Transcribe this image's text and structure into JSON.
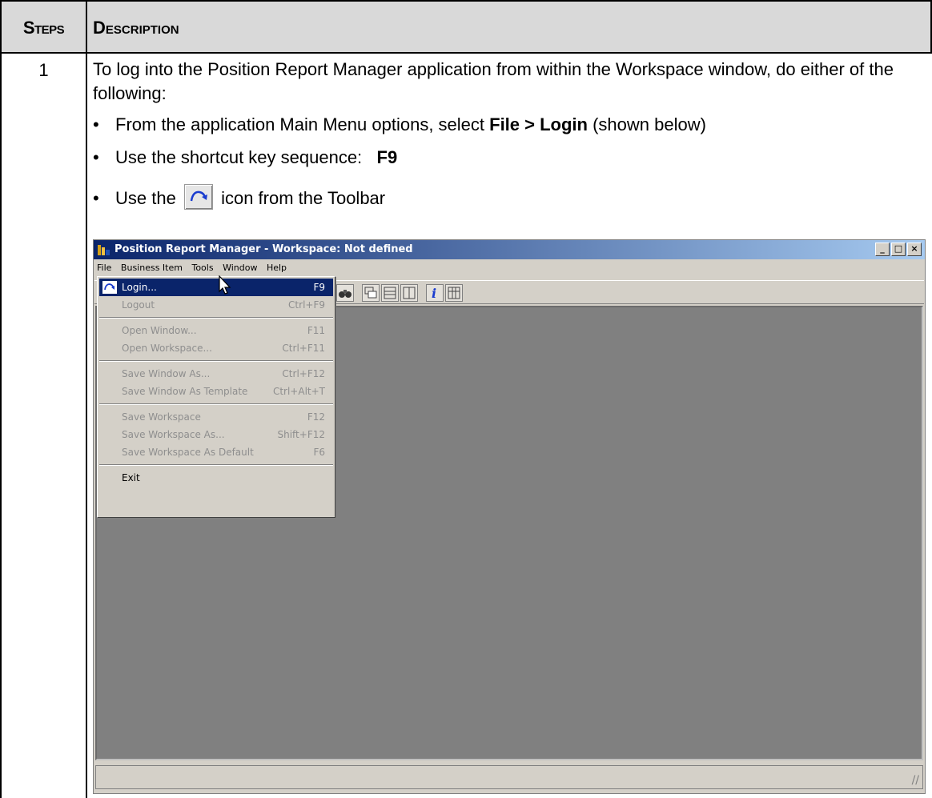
{
  "table": {
    "header_steps": "Steps",
    "header_description": "Description"
  },
  "step": {
    "number": "1",
    "intro": "To log into the Position Report Manager application from within the Workspace window, do either of the following:",
    "bullet1_pre": "From the application Main Menu options, select ",
    "bullet1_bold": "File > Login",
    "bullet1_post": " (shown below)",
    "bullet2_pre": "Use the shortcut key sequence:",
    "bullet2_bold": "F9",
    "bullet3_pre": "Use the",
    "bullet3_post": "icon from the Toolbar"
  },
  "window": {
    "title": "Position Report Manager - Workspace: Not defined",
    "menubar": [
      "File",
      "Business Item",
      "Tools",
      "Window",
      "Help"
    ],
    "file_menu": [
      {
        "label": "Login...",
        "shortcut": "F9",
        "state": "highlighted"
      },
      {
        "label": "Logout",
        "shortcut": "Ctrl+F9",
        "state": "disabled"
      },
      {
        "label": "Open Window...",
        "shortcut": "F11",
        "state": "disabled"
      },
      {
        "label": "Open Workspace...",
        "shortcut": "Ctrl+F11",
        "state": "disabled"
      },
      {
        "label": "Save Window As...",
        "shortcut": "Ctrl+F12",
        "state": "disabled"
      },
      {
        "label": "Save Window As Template",
        "shortcut": "Ctrl+Alt+T",
        "state": "disabled"
      },
      {
        "label": "Save Workspace",
        "shortcut": "F12",
        "state": "disabled"
      },
      {
        "label": "Save Workspace As...",
        "shortcut": "Shift+F12",
        "state": "disabled"
      },
      {
        "label": "Save Workspace As Default",
        "shortcut": "F6",
        "state": "disabled"
      },
      {
        "label": "Exit",
        "shortcut": "",
        "state": "enabled"
      }
    ]
  },
  "colors": {
    "header_bg": "#d9d9d9",
    "titlebar_start": "#0a246a",
    "titlebar_end": "#a6caf0",
    "menu_highlight": "#0a246a",
    "workspace_bg": "#808080"
  }
}
